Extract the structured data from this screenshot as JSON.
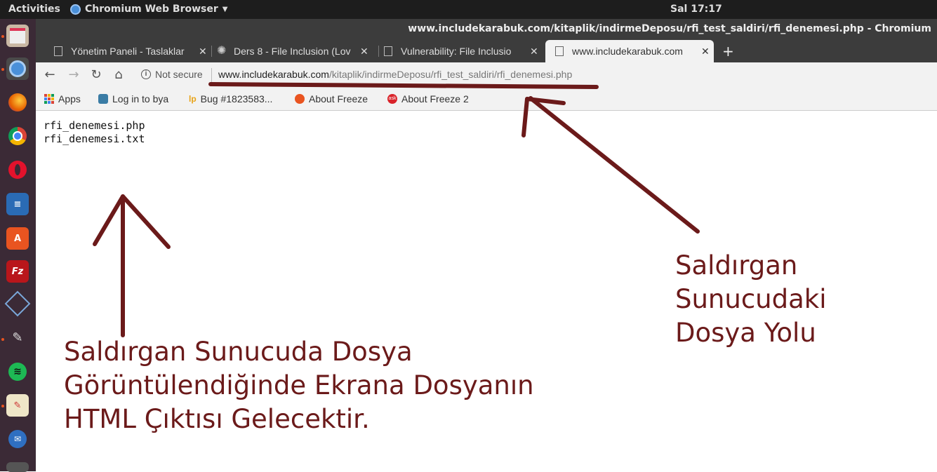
{
  "topbar": {
    "activities": "Activities",
    "app_name": "Chromium Web Browser",
    "clock": "Sal 17:17"
  },
  "window": {
    "title": "www.includekarabuk.com/kitaplik/indirmeDeposu/rfi_test_saldiri/rfi_denemesi.php - Chromium"
  },
  "tabs": [
    {
      "title": "Yönetim Paneli - Taslaklar",
      "icon": "page-icon"
    },
    {
      "title": "Ders 8 - File Inclusion (Lov",
      "icon": "gear-icon"
    },
    {
      "title": "Vulnerability: File Inclusio",
      "icon": "page-icon"
    },
    {
      "title": "www.includekarabuk.com",
      "icon": "page-icon",
      "active": true
    }
  ],
  "toolbar": {
    "security": "Not secure",
    "url_host": "www.includekarabuk.com",
    "url_path": "/kitaplik/indirmeDeposu/rfi_test_saldiri/rfi_denemesi.php"
  },
  "bookmarks": [
    {
      "label": "Apps"
    },
    {
      "label": "Log in to bya"
    },
    {
      "label": "Bug #1823583..."
    },
    {
      "label": "About Freeze"
    },
    {
      "label": "About Freeze 2"
    }
  ],
  "page": {
    "lines": [
      "rfi_denemesi.php",
      "rfi_denemesi.txt"
    ]
  },
  "annotations": {
    "left_caption": [
      "Saldırgan Sunucuda Dosya",
      "Görüntülendiğinde Ekrana Dosyanın",
      "HTML Çıktısı Gelecektir."
    ],
    "right_caption": [
      "Saldırgan",
      "Sunucudaki",
      "Dosya Yolu"
    ],
    "color": "#6b1a1a"
  }
}
